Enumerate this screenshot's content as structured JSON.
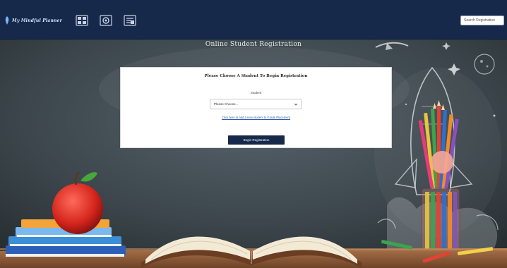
{
  "header": {
    "brand": "My Mindful Planner",
    "nav_icons": [
      "grid-icon",
      "settings-icon",
      "document-icon"
    ],
    "search_placeholder": "Search Registration"
  },
  "main": {
    "page_title": "Online Student Registration",
    "panel": {
      "title": "Please Choose A Student To Begin Registration",
      "student_label": "Student",
      "student_select_value": "Please Choose...",
      "help_link": "Click here to add a new student to Grade Placement",
      "begin_button": "Begin Registration"
    }
  },
  "colors": {
    "navbar": "#17294a",
    "button": "#17294a",
    "link": "#2b5ea8",
    "chalkboard": "#3b4449"
  }
}
